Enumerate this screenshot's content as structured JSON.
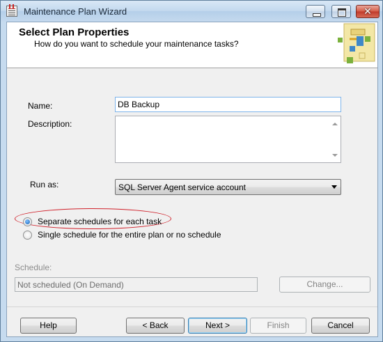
{
  "window": {
    "title": "Maintenance Plan Wizard",
    "close_glyph": "✕"
  },
  "header": {
    "title": "Select Plan Properties",
    "subtitle": "How do you want to schedule your maintenance tasks?"
  },
  "form": {
    "name_label": "Name:",
    "name_value": "DB Backup",
    "description_label": "Description:",
    "description_value": "",
    "run_as_label": "Run as:",
    "run_as_value": "SQL Server Agent service account",
    "radio_options": [
      {
        "label": "Separate schedules for each task",
        "checked": true
      },
      {
        "label": "Single schedule for the entire plan or no schedule",
        "checked": false
      }
    ],
    "schedule_label": "Schedule:",
    "schedule_value": "Not scheduled (On Demand)",
    "change_button": "Change..."
  },
  "footer": {
    "help": "Help",
    "back": "< Back",
    "next": "Next >",
    "finish": "Finish",
    "cancel": "Cancel"
  },
  "colors": {
    "highlight_oval": "#d0202a",
    "titlebar": "#c6dbef"
  }
}
